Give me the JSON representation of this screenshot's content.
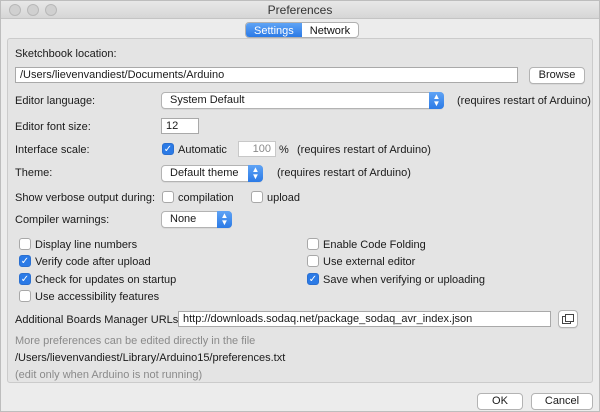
{
  "window": {
    "title": "Preferences"
  },
  "tabs": [
    {
      "label": "Settings",
      "active": true
    },
    {
      "label": "Network",
      "active": false
    }
  ],
  "sketchbook": {
    "label": "Sketchbook location:",
    "path": "/Users/lievenvandiest/Documents/Arduino",
    "browse_label": "Browse"
  },
  "editor_language": {
    "label": "Editor language:",
    "value": "System Default",
    "note": "(requires restart of Arduino)"
  },
  "editor_font_size": {
    "label": "Editor font size:",
    "value": "12"
  },
  "interface_scale": {
    "label": "Interface scale:",
    "automatic_label": "Automatic",
    "automatic_checked": true,
    "value": "100",
    "unit": "%",
    "note": "(requires restart of Arduino)"
  },
  "theme": {
    "label": "Theme:",
    "value": "Default theme",
    "note": "(requires restart of Arduino)"
  },
  "verbose": {
    "label": "Show verbose output during:",
    "compilation_label": "compilation",
    "upload_label": "upload"
  },
  "compiler_warnings": {
    "label": "Compiler warnings:",
    "value": "None"
  },
  "options": {
    "left": [
      {
        "label": "Display line numbers",
        "checked": false
      },
      {
        "label": "Verify code after upload",
        "checked": true
      },
      {
        "label": "Check for updates on startup",
        "checked": true
      },
      {
        "label": "Use accessibility features",
        "checked": false
      }
    ],
    "right": [
      {
        "label": "Enable Code Folding",
        "checked": false
      },
      {
        "label": "Use external editor",
        "checked": false
      },
      {
        "label": "Save when verifying or uploading",
        "checked": true
      }
    ]
  },
  "boards_manager": {
    "label": "Additional Boards Manager URLs:",
    "value": "http://downloads.sodaq.net/package_sodaq_avr_index.json"
  },
  "footer": {
    "more_prefs": "More preferences can be edited directly in the file",
    "prefs_path": "/Users/lievenvandiest/Library/Arduino15/preferences.txt",
    "edit_note": "(edit only when Arduino is not running)"
  },
  "buttons": {
    "ok": "OK",
    "cancel": "Cancel"
  },
  "colors": {
    "accent": "#2b7ae6",
    "panel": "#e4e4e4",
    "window": "#ececec"
  },
  "icons": {
    "select_arrow": "chevron-updown-icon",
    "url_list_button": "window-list-icon"
  }
}
